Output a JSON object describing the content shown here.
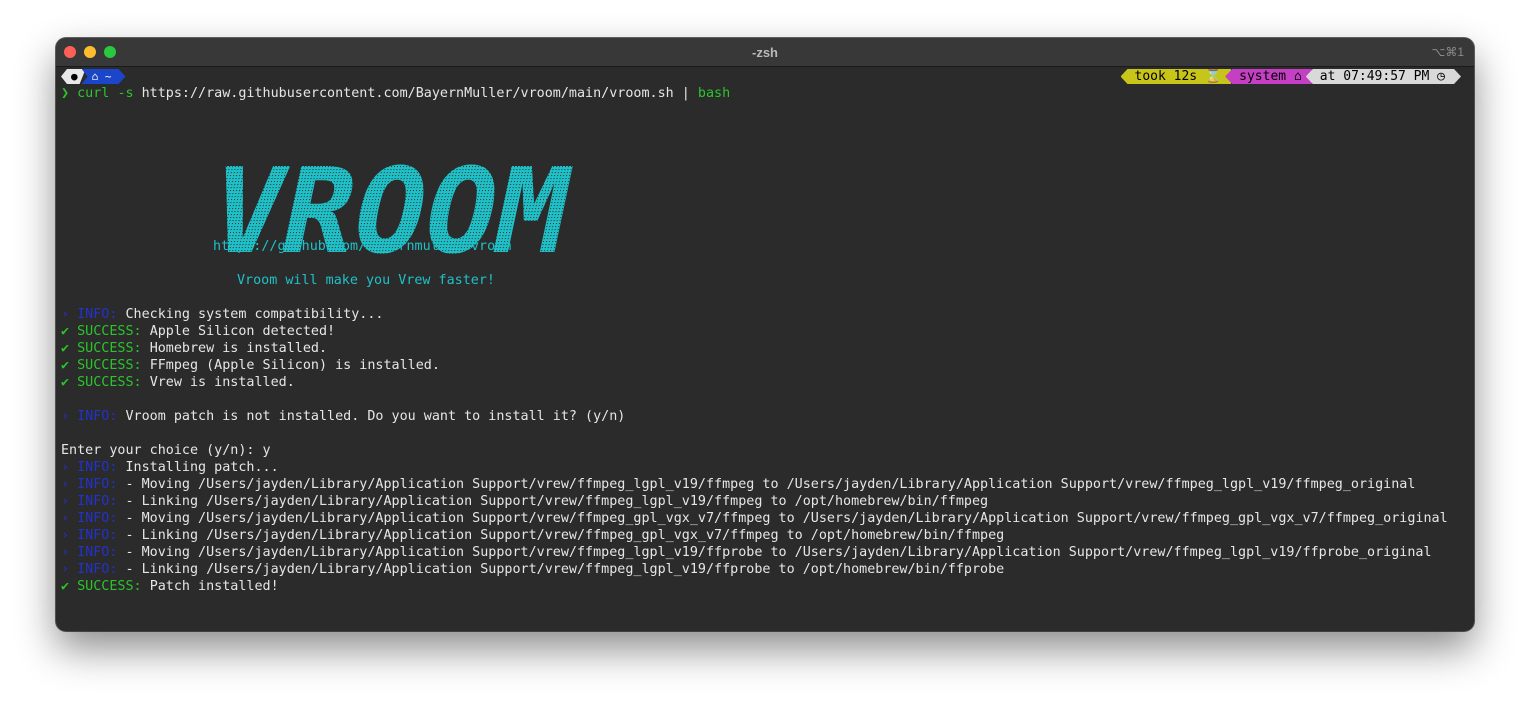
{
  "window": {
    "title": "-zsh",
    "shortcut": "⌥⌘1"
  },
  "prompt": {
    "dir": "~",
    "took": "took 12s",
    "took_icon": "⌛",
    "system": "system",
    "system_icon": "⌂",
    "time": "at 07:49:57 PM",
    "time_icon": "◷",
    "arrow": "❯",
    "cmd_curl": "curl",
    "cmd_flag": "-s",
    "cmd_url": "https://raw.githubusercontent.com/BayernMuller/vroom/main/vroom.sh",
    "cmd_pipe": "|",
    "cmd_bash": "bash"
  },
  "banner": {
    "logo_text": "VROOM",
    "url": "https://github.com/bayernmuller/vroom",
    "tagline": "Vroom will make you Vrew faster!"
  },
  "log": {
    "info_prefix": "› INFO:",
    "success_prefix": "✔ SUCCESS:",
    "check": "Checking system compatibility...",
    "s1": "Apple Silicon detected!",
    "s2": "Homebrew is installed.",
    "s3": "FFmpeg (Apple Silicon) is installed.",
    "s4": "Vrew is installed.",
    "ask": "Vroom patch is not installed. Do you want to install it? (y/n)",
    "choice": "Enter your choice (y/n): y",
    "installing": "Installing patch...",
    "m1": "- Moving /Users/jayden/Library/Application Support/vrew/ffmpeg_lgpl_v19/ffmpeg to /Users/jayden/Library/Application Support/vrew/ffmpeg_lgpl_v19/ffmpeg_original",
    "m2": "- Linking /Users/jayden/Library/Application Support/vrew/ffmpeg_lgpl_v19/ffmpeg to /opt/homebrew/bin/ffmpeg",
    "m3": "- Moving /Users/jayden/Library/Application Support/vrew/ffmpeg_gpl_vgx_v7/ffmpeg to /Users/jayden/Library/Application Support/vrew/ffmpeg_gpl_vgx_v7/ffmpeg_original",
    "m4": "- Linking /Users/jayden/Library/Application Support/vrew/ffmpeg_gpl_vgx_v7/ffmpeg to /opt/homebrew/bin/ffmpeg",
    "m5": "- Moving /Users/jayden/Library/Application Support/vrew/ffmpeg_lgpl_v19/ffprobe to /Users/jayden/Library/Application Support/vrew/ffmpeg_lgpl_v19/ffprobe_original",
    "m6": "- Linking /Users/jayden/Library/Application Support/vrew/ffmpeg_lgpl_v19/ffprobe to /opt/homebrew/bin/ffprobe",
    "done": "Patch installed!"
  },
  "colors": {
    "success": "#2bc52b",
    "info": "#2233c8",
    "cyan": "#1ec1c8"
  }
}
